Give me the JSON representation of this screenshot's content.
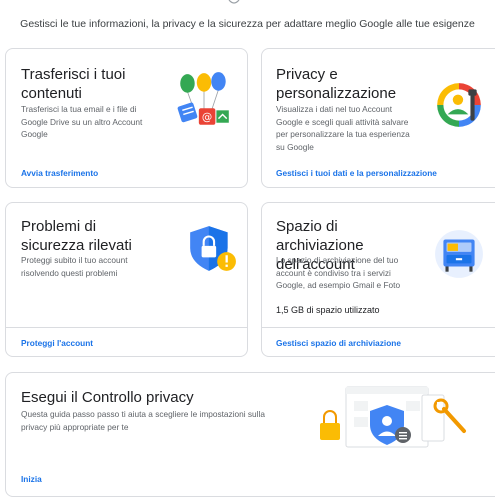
{
  "header": {
    "subtitle": "Gestisci le tue informazioni, la privacy e la sicurezza per adattare meglio Google alle tue esigenze"
  },
  "cards": {
    "transfer": {
      "title": "Trasferisci i tuoi contenuti",
      "description": "Trasferisci la tua email e i file di Google Drive su un altro Account Google",
      "link": "Avvia trasferimento"
    },
    "privacy": {
      "title": "Privacy e personalizzazione",
      "description": "Visualizza i dati nel tuo Account Google e scegli quali attività salvare per personalizzare la tua esperienza su Google",
      "link": "Gestisci i tuoi dati e la personalizzazione"
    },
    "security": {
      "title": "Problemi di sicurezza rilevati",
      "description": "Proteggi subito il tuo account risolvendo questi problemi",
      "link": "Proteggi l'account"
    },
    "storage": {
      "title": "Spazio di archiviazione dell'account",
      "description": "Lo spazio di archiviazione del tuo account è condiviso tra i servizi Google, ad esempio Gmail e Foto",
      "usage": "1,5 GB di spazio utilizzato",
      "link": "Gestisci spazio di archiviazione"
    },
    "checkup": {
      "title": "Esegui il Controllo privacy",
      "description": "Questa guida passo passo ti aiuta a scegliere le impostazioni sulla privacy più appropriate per te",
      "link": "Inizia"
    }
  },
  "colors": {
    "link": "#1a73e8",
    "border": "#dadce0",
    "google_blue": "#4285f4",
    "google_red": "#ea4335",
    "google_yellow": "#fbbc04",
    "google_green": "#34a853"
  }
}
